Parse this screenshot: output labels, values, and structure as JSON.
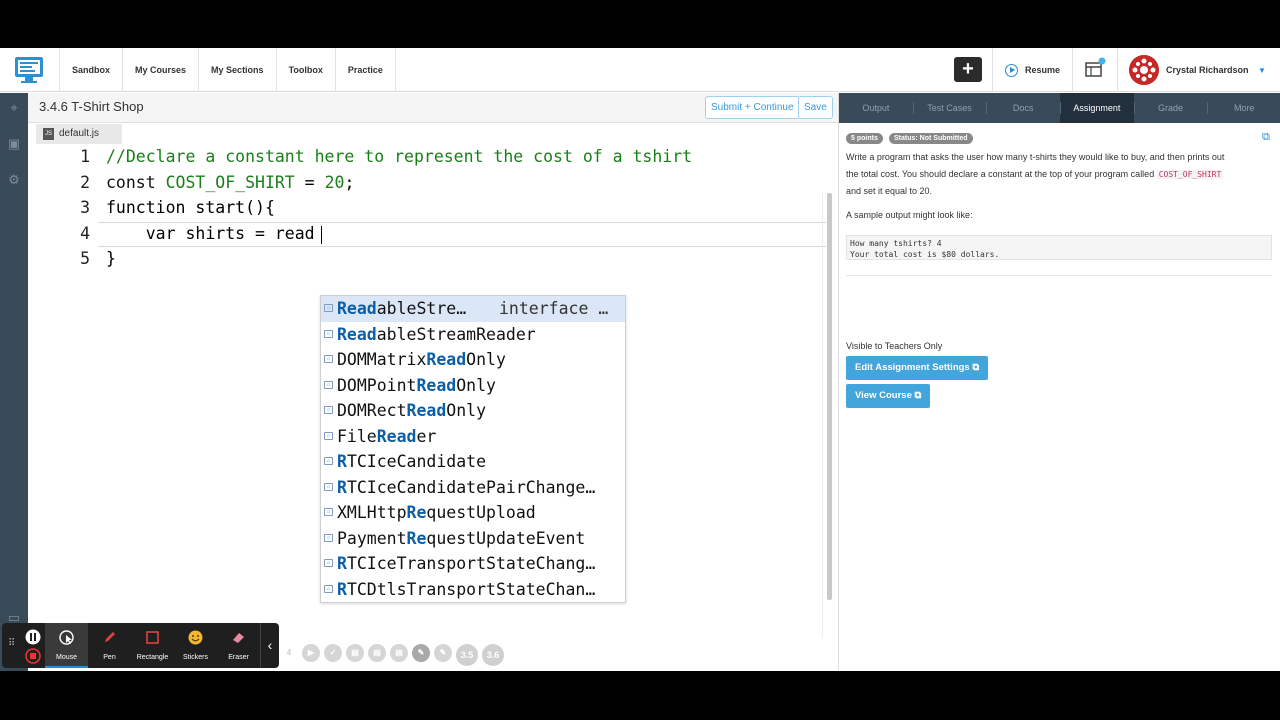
{
  "nav": {
    "links": [
      "Sandbox",
      "My Courses",
      "My Sections",
      "Toolbox",
      "Practice"
    ],
    "plus_label": "+",
    "resume_label": "Resume",
    "user_name": "Crystal Richardson"
  },
  "editor": {
    "title": "3.4.6 T-Shirt Shop",
    "submit_label": "Submit + Continue",
    "save_label": "Save",
    "file_tab": "default.js",
    "file_badge": "JS",
    "line_numbers": [
      "1",
      "2",
      "3",
      "4",
      "5"
    ],
    "lines": {
      "l1": "//Declare a constant here to represent the cost of a tshirt",
      "l2_kw": "const",
      "l2_name": " COST_OF_SHIRT",
      "l2_eq": " = ",
      "l2_val": "20",
      "l2_end": ";",
      "l3": "function start(){",
      "l4": "    var shirts = read",
      "l5": "}"
    },
    "autocomplete": [
      {
        "pre": "",
        "hl": "Read",
        "post": "ableStre…",
        "detail": "interface …"
      },
      {
        "pre": "",
        "hl": "Read",
        "post": "ableStreamReader",
        "detail": ""
      },
      {
        "pre": "DOMMatrix",
        "hl": "Read",
        "post": "Only",
        "detail": ""
      },
      {
        "pre": "DOMPoint",
        "hl": "Read",
        "post": "Only",
        "detail": ""
      },
      {
        "pre": "DOMRect",
        "hl": "Read",
        "post": "Only",
        "detail": ""
      },
      {
        "pre": "File",
        "hl": "Read",
        "post": "er",
        "detail": ""
      },
      {
        "pre": "",
        "hl": "R",
        "post": "TCIceCandidate",
        "detail": ""
      },
      {
        "pre": "",
        "hl": "R",
        "post": "TCIceCandidatePairChange…",
        "detail": ""
      },
      {
        "pre": "XMLHttp",
        "hl": "Re",
        "post": "questUpload",
        "detail": ""
      },
      {
        "pre": "Payment",
        "hl": "Re",
        "post": "questUpdateEvent",
        "detail": ""
      },
      {
        "pre": "",
        "hl": "R",
        "post": "TCIceTransportStateChang…",
        "detail": ""
      },
      {
        "pre": "",
        "hl": "R",
        "post": "TCDtlsTransportStateChan…",
        "detail": ""
      }
    ]
  },
  "panel": {
    "tabs": [
      "Output",
      "Test Cases",
      "Docs",
      "Assignment",
      "Grade",
      "More"
    ],
    "active_tab": "Assignment",
    "points_pill": "5 points",
    "status_pill": "Status: Not Submitted",
    "desc_1": "Write a program that asks the user how many t-shirts they would like to buy, and then prints out",
    "desc_2a": "the total cost. You should declare a constant at the top of your program called ",
    "desc_code": "COST_OF_SHIRT",
    "desc_3": "and set it equal to 20.",
    "sample_label": "A sample output might look like:",
    "sample_line1": "How many tshirts? 4",
    "sample_line2": "Your total cost is $80 dollars.",
    "teachers_label": "Visible to Teachers Only",
    "edit_settings_label": "Edit Assignment Settings",
    "view_course_label": "View Course"
  },
  "toolbar": {
    "items": [
      "Mouse",
      "Pen",
      "Rectangle",
      "Stickers",
      "Eraser"
    ],
    "active": "Mouse",
    "progress_badges": [
      "4",
      "3.5",
      "3.6"
    ]
  },
  "colors": {
    "accent": "#2a8ad4",
    "panel_dark": "#394a59",
    "comment_green": "#1a7f1a",
    "button_blue": "#42a5dc"
  }
}
